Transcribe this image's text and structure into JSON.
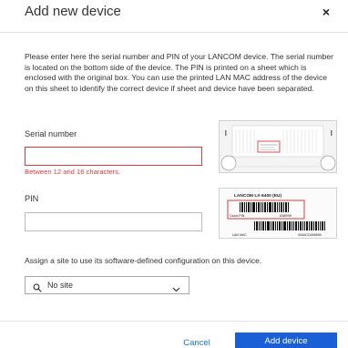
{
  "dialog": {
    "title": "Add new device",
    "close_glyph": "×",
    "intro": "Please enter here the serial number and PIN of your LANCOM device. The serial number is located on the bottom side of the device. The PIN is printed on a sheet which is enclosed with the original box. You can use the printed LAN MAC address of the device on this sheet to identify the correct device if sheet and device have been separated."
  },
  "serial": {
    "label": "Serial number",
    "value": "",
    "error": "Between 12 and 16 characters."
  },
  "pin": {
    "label": "PIN",
    "value": ""
  },
  "sheet_image": {
    "model": "LANCOM LX-6400 (EU)",
    "cloud_pin_label": "Cloud PIN",
    "cloud_pin_value": "6389/99",
    "lan_mac_label": "LAN MAC",
    "lan_mac_value": "00A0CD456696"
  },
  "site": {
    "assign_text": "Assign a site to use its software-defined configuration on this device.",
    "selected": "No site"
  },
  "footer": {
    "cancel_label": "Cancel",
    "add_label": "Add device"
  },
  "colors": {
    "accent": "#1a5fd6",
    "link": "#1a73d9",
    "error": "#e0383b"
  }
}
